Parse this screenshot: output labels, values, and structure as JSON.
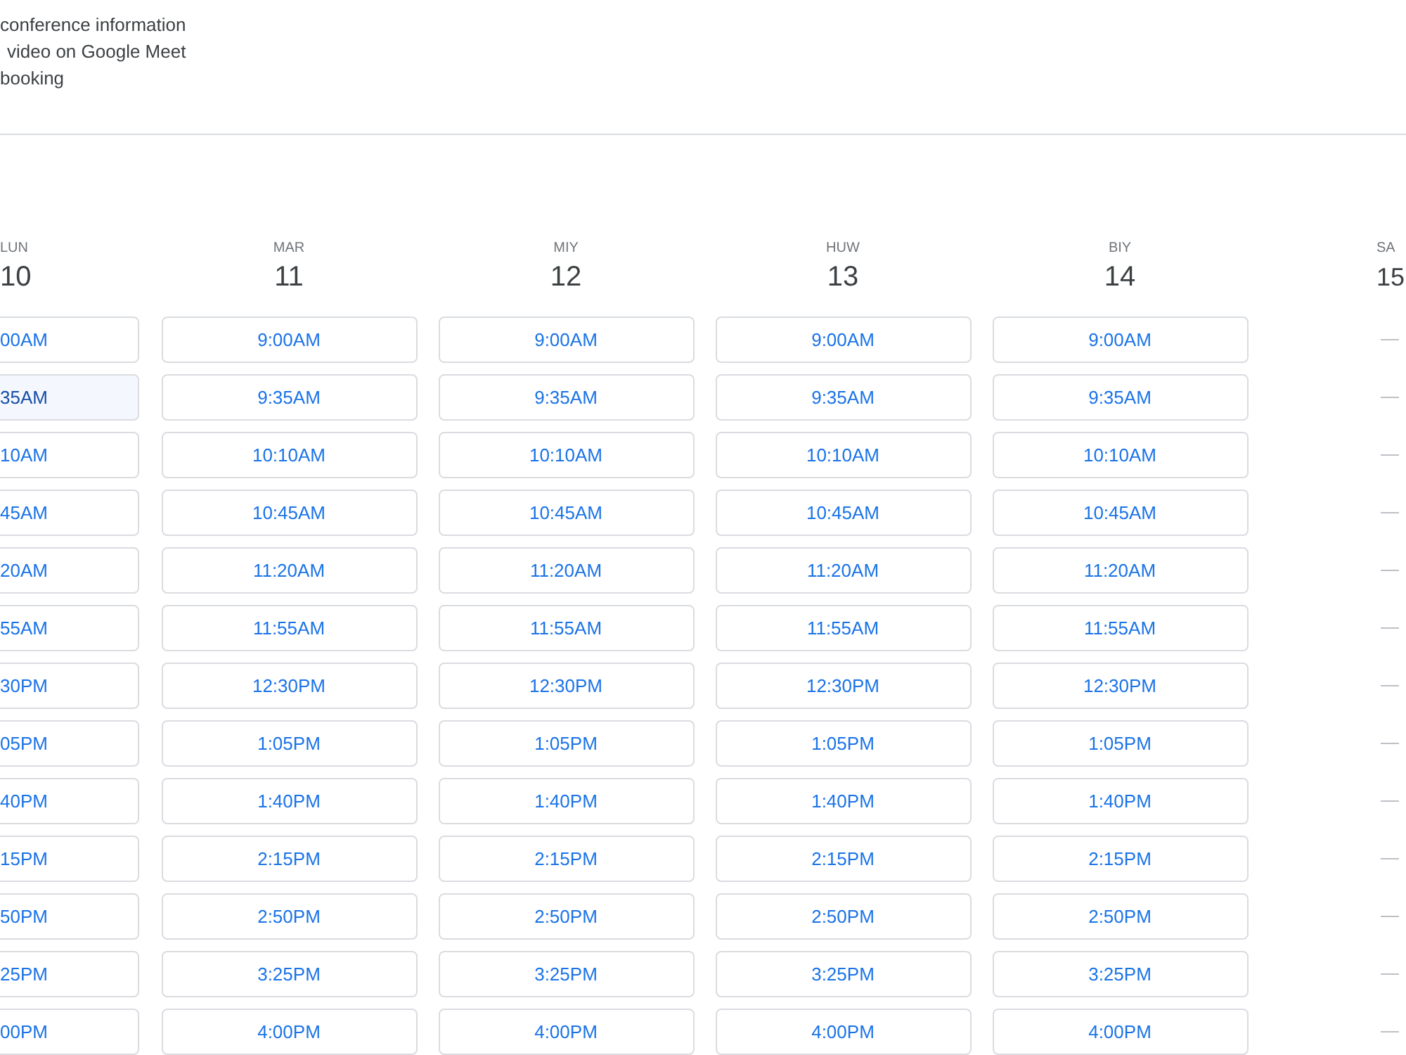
{
  "details": [
    "conference information",
    "video on Google Meet",
    "booking"
  ],
  "days": [
    {
      "kind": "clipped",
      "label": "LUN",
      "date": "10",
      "slots": [
        {
          "time": "00AM",
          "selected": false
        },
        {
          "time": "35AM",
          "selected": true
        },
        {
          "time": "10AM",
          "selected": false
        },
        {
          "time": "45AM",
          "selected": false
        },
        {
          "time": "20AM",
          "selected": false
        },
        {
          "time": "55AM",
          "selected": false
        },
        {
          "time": "30PM",
          "selected": false
        },
        {
          "time": "05PM",
          "selected": false
        },
        {
          "time": "40PM",
          "selected": false
        },
        {
          "time": "15PM",
          "selected": false
        },
        {
          "time": "50PM",
          "selected": false
        },
        {
          "time": "25PM",
          "selected": false
        },
        {
          "time": "00PM",
          "selected": false
        }
      ]
    },
    {
      "kind": "available",
      "label": "MAR",
      "date": "11",
      "slots": [
        {
          "time": "9:00AM",
          "selected": false
        },
        {
          "time": "9:35AM",
          "selected": false
        },
        {
          "time": "10:10AM",
          "selected": false
        },
        {
          "time": "10:45AM",
          "selected": false
        },
        {
          "time": "11:20AM",
          "selected": false
        },
        {
          "time": "11:55AM",
          "selected": false
        },
        {
          "time": "12:30PM",
          "selected": false
        },
        {
          "time": "1:05PM",
          "selected": false
        },
        {
          "time": "1:40PM",
          "selected": false
        },
        {
          "time": "2:15PM",
          "selected": false
        },
        {
          "time": "2:50PM",
          "selected": false
        },
        {
          "time": "3:25PM",
          "selected": false
        },
        {
          "time": "4:00PM",
          "selected": false
        }
      ]
    },
    {
      "kind": "available",
      "label": "MIY",
      "date": "12",
      "slots": [
        {
          "time": "9:00AM",
          "selected": false
        },
        {
          "time": "9:35AM",
          "selected": false
        },
        {
          "time": "10:10AM",
          "selected": false
        },
        {
          "time": "10:45AM",
          "selected": false
        },
        {
          "time": "11:20AM",
          "selected": false
        },
        {
          "time": "11:55AM",
          "selected": false
        },
        {
          "time": "12:30PM",
          "selected": false
        },
        {
          "time": "1:05PM",
          "selected": false
        },
        {
          "time": "1:40PM",
          "selected": false
        },
        {
          "time": "2:15PM",
          "selected": false
        },
        {
          "time": "2:50PM",
          "selected": false
        },
        {
          "time": "3:25PM",
          "selected": false
        },
        {
          "time": "4:00PM",
          "selected": false
        }
      ]
    },
    {
      "kind": "available",
      "label": "HUW",
      "date": "13",
      "slots": [
        {
          "time": "9:00AM",
          "selected": false
        },
        {
          "time": "9:35AM",
          "selected": false
        },
        {
          "time": "10:10AM",
          "selected": false
        },
        {
          "time": "10:45AM",
          "selected": false
        },
        {
          "time": "11:20AM",
          "selected": false
        },
        {
          "time": "11:55AM",
          "selected": false
        },
        {
          "time": "12:30PM",
          "selected": false
        },
        {
          "time": "1:05PM",
          "selected": false
        },
        {
          "time": "1:40PM",
          "selected": false
        },
        {
          "time": "2:15PM",
          "selected": false
        },
        {
          "time": "2:50PM",
          "selected": false
        },
        {
          "time": "3:25PM",
          "selected": false
        },
        {
          "time": "4:00PM",
          "selected": false
        }
      ]
    },
    {
      "kind": "available",
      "label": "BIY",
      "date": "14",
      "slots": [
        {
          "time": "9:00AM",
          "selected": false
        },
        {
          "time": "9:35AM",
          "selected": false
        },
        {
          "time": "10:10AM",
          "selected": false
        },
        {
          "time": "10:45AM",
          "selected": false
        },
        {
          "time": "11:20AM",
          "selected": false
        },
        {
          "time": "11:55AM",
          "selected": false
        },
        {
          "time": "12:30PM",
          "selected": false
        },
        {
          "time": "1:05PM",
          "selected": false
        },
        {
          "time": "1:40PM",
          "selected": false
        },
        {
          "time": "2:15PM",
          "selected": false
        },
        {
          "time": "2:50PM",
          "selected": false
        },
        {
          "time": "3:25PM",
          "selected": false
        },
        {
          "time": "4:00PM",
          "selected": false
        }
      ]
    },
    {
      "kind": "unavailable",
      "label": "SA",
      "date": "15"
    }
  ]
}
